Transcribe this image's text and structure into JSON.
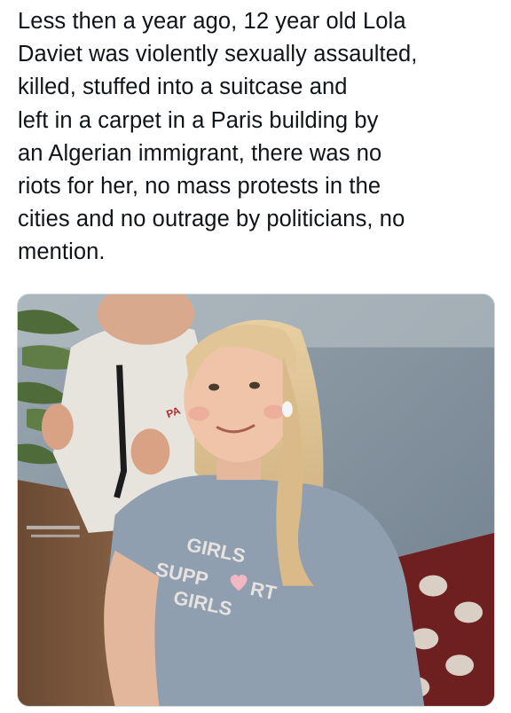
{
  "post": {
    "text_lines": [
      "Less then a year ago, 12 year old Lola",
      "Daviet was violently sexually assaulted,",
      "killed, stuffed into a suitcase and",
      "left in a carpet in a Paris building by",
      "an Algerian immigrant, there was no",
      "riots for her, no mass protests in the",
      "cities and no outrage by politicians, no",
      "mention."
    ]
  },
  "media": {
    "shirt_line1": "GIRLS",
    "shirt_line2": "SUPP",
    "shirt_line2b": "RT",
    "shirt_line3": "GIRLS",
    "hoodie_text": "PA"
  },
  "colors": {
    "text": "#0f1419",
    "border": "#cfd9de",
    "shirt": "#8f9fb0",
    "shirt_print": "#e6e2df",
    "heart": "#f3b7c4"
  }
}
